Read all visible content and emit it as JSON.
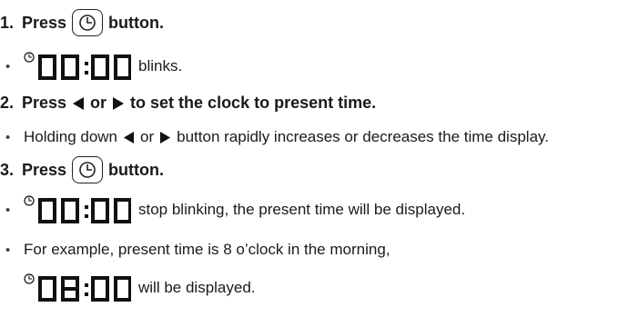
{
  "step1": {
    "number": "1.",
    "before": "Press",
    "after": "button."
  },
  "bullet1": {
    "text": "blinks."
  },
  "step2": {
    "number": "2.",
    "before": "Press",
    "or": "or",
    "after": "to set the clock to present time."
  },
  "bullet2": {
    "before": "Holding down",
    "or": "or",
    "after": "button rapidly increases or decreases the time display."
  },
  "step3": {
    "number": "3.",
    "before": "Press",
    "after": "button."
  },
  "bullet3": {
    "text": "stop blinking, the present time will be displayed."
  },
  "bullet4": {
    "text": "For example, present time is 8 o’clock in the morning,"
  },
  "example": {
    "text": "will be displayed."
  },
  "bullet_symbol": "•",
  "icons": {
    "clock_button": "clock-icon",
    "left": "left-triangle-icon",
    "right": "right-triangle-icon",
    "display": "lcd-display"
  },
  "displays": {
    "blink": "00:00",
    "example": "08:00"
  }
}
